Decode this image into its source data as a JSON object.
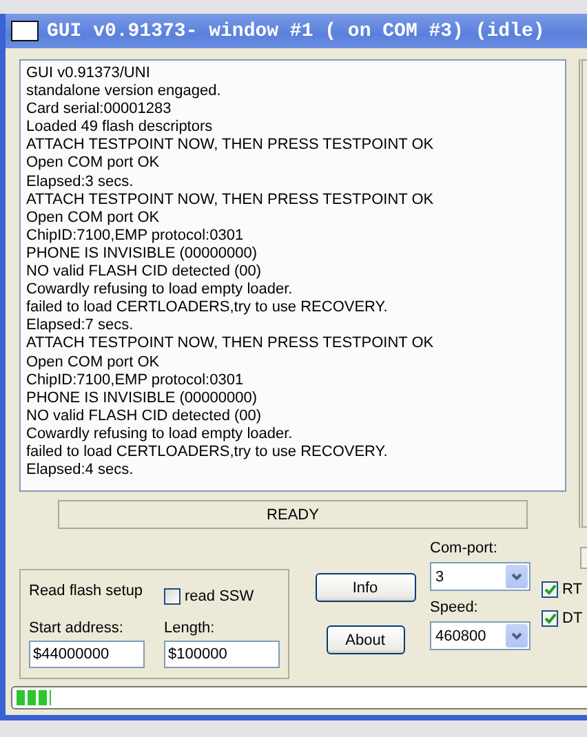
{
  "window": {
    "title": "GUI v0.91373- window #1 ( on COM #3) (idle)"
  },
  "log": [
    "GUI v0.91373/UNI",
    "standalone version engaged.",
    "Card serial:00001283",
    "Loaded 49 flash descriptors",
    "ATTACH TESTPOINT NOW, THEN PRESS TESTPOINT OK",
    "Open COM port OK",
    "Elapsed:3 secs.",
    "ATTACH TESTPOINT NOW, THEN PRESS TESTPOINT OK",
    "Open COM port OK",
    "ChipID:7100,EMP protocol:0301",
    "PHONE IS INVISIBLE (00000000)",
    "NO valid FLASH CID detected (00)",
    "Cowardly refusing to load empty loader.",
    "failed to load CERTLOADERS,try to use RECOVERY.",
    "Elapsed:7 secs.",
    "ATTACH TESTPOINT NOW, THEN PRESS TESTPOINT OK",
    "Open COM port OK",
    "ChipID:7100,EMP protocol:0301",
    "PHONE IS INVISIBLE (00000000)",
    "NO valid FLASH CID detected (00)",
    "Cowardly refusing to load empty loader.",
    "failed to load CERTLOADERS,try to use RECOVERY.",
    "Elapsed:4 secs."
  ],
  "status": "READY",
  "read_flash": {
    "title": "Read flash setup",
    "read_ssw": {
      "label": "read SSW",
      "checked": false
    },
    "start_label": "Start address:",
    "start_value": "$44000000",
    "length_label": "Length:",
    "length_value": "$100000"
  },
  "buttons": [
    "Info",
    "About"
  ],
  "com_port": {
    "label": "Com-port:",
    "value": "3"
  },
  "speed": {
    "label": "Speed:",
    "value": "460800"
  },
  "lines": [
    {
      "label": "RT",
      "checked": true
    },
    {
      "label": "DT",
      "checked": true
    }
  ],
  "progress": {
    "level": 0.06
  }
}
